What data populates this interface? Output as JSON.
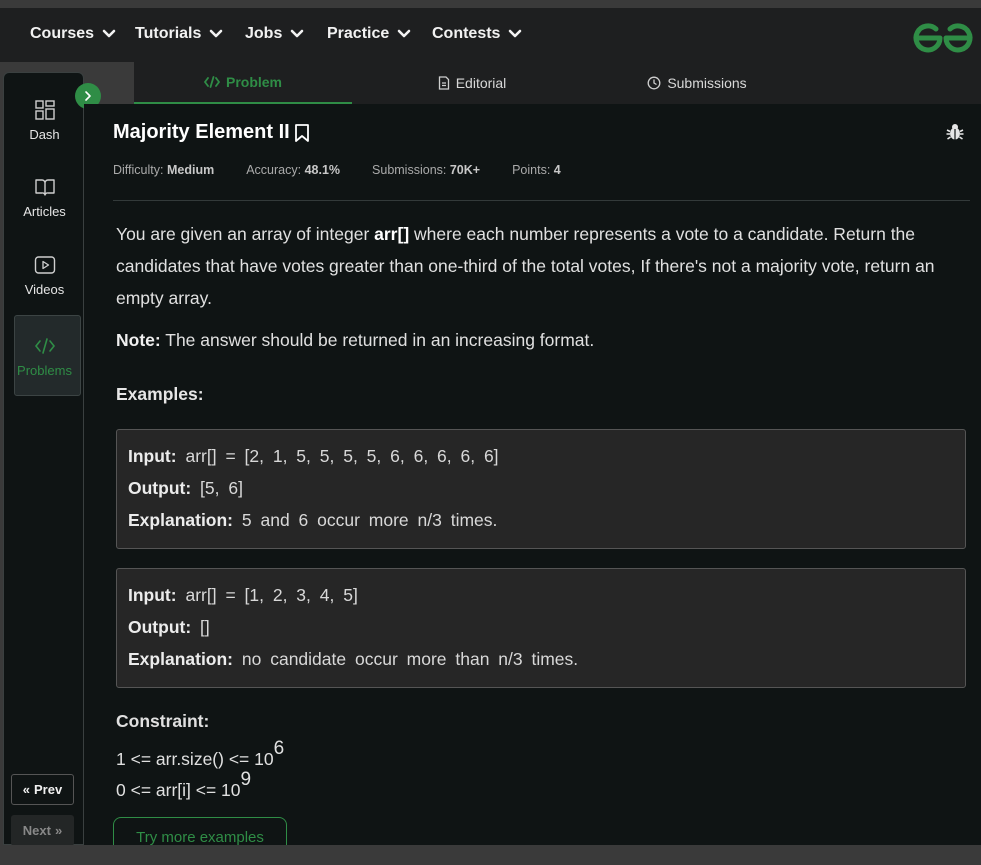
{
  "nav": {
    "items": [
      {
        "label": "Courses"
      },
      {
        "label": "Tutorials"
      },
      {
        "label": "Jobs"
      },
      {
        "label": "Practice"
      },
      {
        "label": "Contests"
      }
    ],
    "logo_icon": "gfg-logo-icon",
    "accent": "#2f8d46"
  },
  "tabs": [
    {
      "label": "Problem",
      "icon": "code-icon"
    },
    {
      "label": "Editorial",
      "icon": "document-icon"
    },
    {
      "label": "Submissions",
      "icon": "clock-icon"
    }
  ],
  "sidebar": {
    "items": [
      {
        "label": "Dash",
        "icon": "dashboard-icon"
      },
      {
        "label": "Articles",
        "icon": "book-icon"
      },
      {
        "label": "Videos",
        "icon": "play-icon"
      },
      {
        "label": "Problems",
        "icon": "code-icon"
      }
    ],
    "prev_label": "Prev",
    "next_label": "Next"
  },
  "problem": {
    "title": "Majority Element II",
    "meta": {
      "difficulty_label": "Difficulty:",
      "difficulty": "Medium",
      "accuracy_label": "Accuracy:",
      "accuracy": "48.1%",
      "submissions_label": "Submissions:",
      "submissions": "70K+",
      "points_label": "Points:",
      "points": "4"
    },
    "desc_1": "You are given an array of integer ",
    "desc_bold": "arr[]",
    "desc_2": " where each number represents a vote to a candidate. Return the candidates that have votes greater than one-third of the total votes, If there's not a majority vote, return an empty array.",
    "note_label": "Note:",
    "note_text": " The answer should be returned in an increasing format.",
    "examples_heading": "Examples:",
    "examples": [
      {
        "input_label": "Input:",
        "input": "arr[] = [2, 1, 5, 5, 5, 5, 6, 6, 6, 6, 6]",
        "output_label": "Output:",
        "output": "[5, 6]",
        "explanation_label": "Explanation:",
        "explanation": "5 and 6 occur more n/3 times."
      },
      {
        "input_label": "Input:",
        "input": "arr[] = [1, 2, 3, 4, 5]",
        "output_label": "Output:",
        "output": "[]",
        "explanation_label": "Explanation:",
        "explanation": "no candidate occur more than n/3 times."
      }
    ],
    "constraint_heading": "Constraint:",
    "constraint_1_base": "1 <= arr.size() <= 10",
    "constraint_1_exp": "6",
    "constraint_2_base": "0 <= arr[i] <= 10",
    "constraint_2_exp": "9",
    "try_label": "Try more examples"
  }
}
